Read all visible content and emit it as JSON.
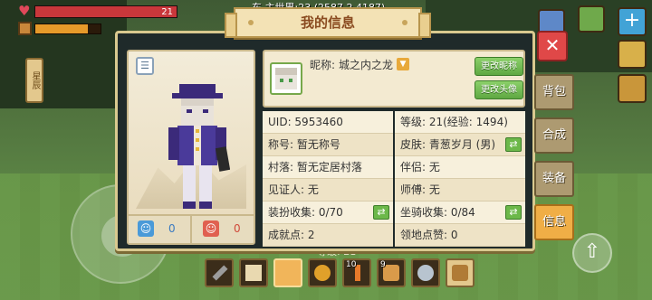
{
  "hud": {
    "hp_value": "21",
    "coords_text": "东 主世界:23 (2587,2,4187)",
    "floor_level_text": "等级: 21",
    "side_tab_text": "星辰",
    "jump_icon": "arrow-up"
  },
  "dialog": {
    "title": "我的信息",
    "close_symbol": "✕"
  },
  "profile": {
    "nickname_label": "昵称:",
    "nickname_value": "城之内之龙",
    "edit_name_button": "更改昵称",
    "edit_avatar_button": "更改头像",
    "likes_blue": "0",
    "likes_red": "0"
  },
  "stats": {
    "uid": "UID: 5953460",
    "level": "等级: 21(经验: 1494)",
    "title": "称号: 暂无称号",
    "skin": "皮肤: 青葱岁月 (男)",
    "village": "村落: 暂无定居村落",
    "partner": "伴侣: 无",
    "witness": "见证人: 无",
    "master": "师傅: 无",
    "outfit_collection": "装扮收集: 0/70",
    "mount_collection": "坐骑收集: 0/84",
    "achievement_points": "成就点: 2",
    "territory_likes": "领地点赞: 0"
  },
  "tabs": {
    "items": [
      "背包",
      "合成",
      "装备",
      "信息"
    ],
    "active_index": 3
  },
  "hotbar": {
    "slot_counts": [
      "",
      "",
      "",
      "",
      "10",
      "9",
      "",
      ""
    ],
    "selected_index": 2
  },
  "colors": {
    "panel_bg": "#1f2a2a",
    "panel_border": "#d9c98f",
    "tab_active": "#f0ae46",
    "tab_inactive": "#ad9a71",
    "green_button": "#5fa842",
    "close_red": "#e04848"
  }
}
